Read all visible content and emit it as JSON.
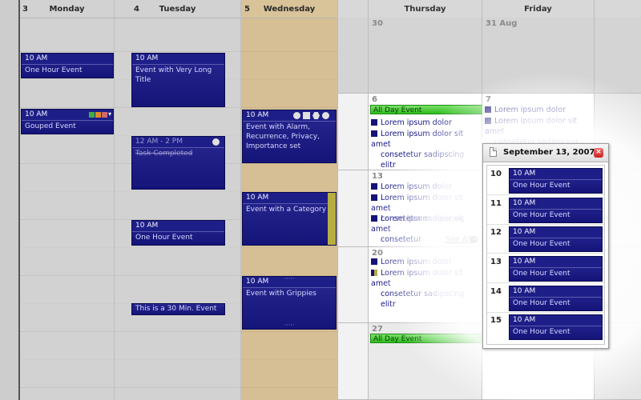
{
  "week": {
    "days": [
      {
        "num": "3",
        "name": "Monday"
      },
      {
        "num": "4",
        "name": "Tuesday"
      },
      {
        "num": "5",
        "name": "Wednesday"
      }
    ],
    "monday_events": [
      {
        "time": "10 AM",
        "title": "One Hour Event"
      },
      {
        "time": "10 AM",
        "title": "Gouped Event"
      }
    ],
    "tuesday_events": [
      {
        "time": "10 AM",
        "title": "Event with Very Long Title"
      },
      {
        "time": "12 AM - 2 PM",
        "title": "Task Completed"
      },
      {
        "time": "10 AM",
        "title": "One Hour Event"
      },
      {
        "title": "This is a 30 Min. Event"
      }
    ],
    "wednesday_events": [
      {
        "time": "10 AM",
        "title": "Event with Alarm, Recurrence, Privacy, Importance set"
      },
      {
        "time": "10 AM",
        "title": "Event with a Category"
      },
      {
        "time": "10 AM",
        "title": "Event with Grippies"
      }
    ],
    "group_colors": [
      "#3fae3f",
      "#e28a2a",
      "#d06a6a"
    ],
    "category_color": "#b7ad42"
  },
  "month": {
    "headers": [
      "Thursday",
      "Friday"
    ],
    "cells": {
      "c30": "30",
      "c31": "31 Aug",
      "c6": "6",
      "c7": "7",
      "c13": "13",
      "c20": "20",
      "c27": "27"
    },
    "all_day": "All Day Event",
    "short": "Lorem ipsum dolor",
    "long_1": "Lorem ipsum dolor sit amet",
    "long_2": "consetetur sadipscing elitr",
    "long_2b": "consetetur sadipscing",
    "long_3": "consetetur",
    "see_all": "See All"
  },
  "popup": {
    "title": "September 13, 2007",
    "close": "×",
    "rows": [
      {
        "hour": "10",
        "time": "10 AM",
        "title": "One Hour Event"
      },
      {
        "hour": "11",
        "time": "10 AM",
        "title": "One Hour Event"
      },
      {
        "hour": "12",
        "time": "10 AM",
        "title": "One Hour Event"
      },
      {
        "hour": "13",
        "time": "10 AM",
        "title": "One Hour Event"
      },
      {
        "hour": "14",
        "time": "10 AM",
        "title": "One Hour Event"
      },
      {
        "hour": "15",
        "time": "10 AM",
        "title": "One Hour Event"
      }
    ]
  },
  "colors": {
    "event_bg": "#141479",
    "all_day_green": "#2cbc1a",
    "wednesday_bg": "#d6bf95"
  }
}
